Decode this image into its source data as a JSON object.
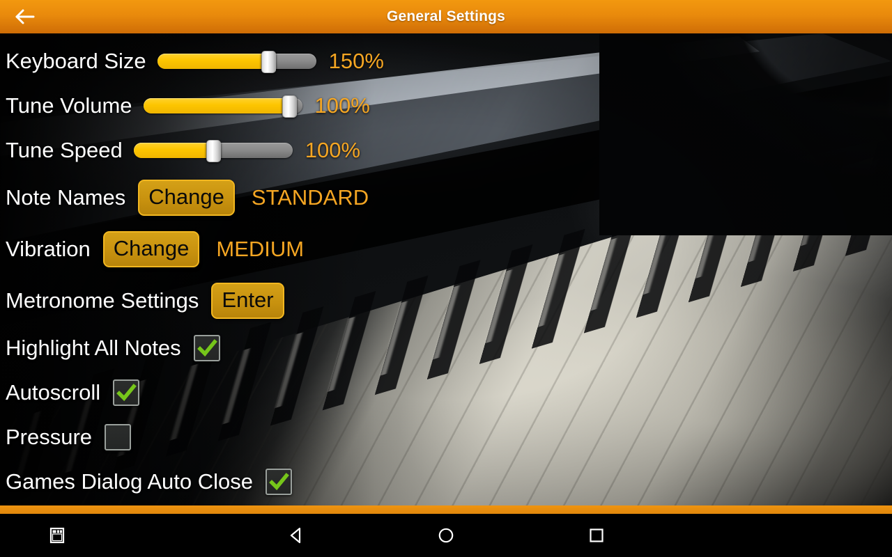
{
  "titlebar": {
    "title": "General Settings",
    "back_icon": "arrow-left-icon",
    "bg_start": "#f2980f",
    "bg_end": "#cf6d06"
  },
  "theme": {
    "label_color": "#ffffff",
    "value_color": "#f5a623",
    "slider_fill": "#fdc500",
    "slider_track": "#8c8c8c",
    "button_fill": "#c8920f",
    "button_border": "#f2b720",
    "check_color": "#76c61a"
  },
  "settings": {
    "rows": [
      {
        "type": "slider",
        "name": "keyboard-size",
        "label": "Keyboard Size",
        "value": "150%",
        "percent": 72
      },
      {
        "type": "slider",
        "name": "tune-volume",
        "label": "Tune Volume",
        "value": "100%",
        "percent": 96
      },
      {
        "type": "slider",
        "name": "tune-speed",
        "label": "Tune Speed",
        "value": "100%",
        "percent": 50
      },
      {
        "type": "button",
        "name": "note-names",
        "label": "Note Names",
        "button": "Change",
        "value": "STANDARD"
      },
      {
        "type": "button",
        "name": "vibration",
        "label": "Vibration",
        "button": "Change",
        "value": "MEDIUM"
      },
      {
        "type": "button",
        "name": "metronome-settings",
        "label": "Metronome Settings",
        "button": "Enter",
        "value": ""
      },
      {
        "type": "checkbox",
        "name": "highlight-all-notes",
        "label": "Highlight All Notes",
        "checked": true
      },
      {
        "type": "checkbox",
        "name": "autoscroll",
        "label": "Autoscroll",
        "checked": true
      },
      {
        "type": "checkbox",
        "name": "pressure",
        "label": "Pressure",
        "checked": false
      },
      {
        "type": "checkbox",
        "name": "games-dialog-auto-close",
        "label": "Games Dialog Auto Close",
        "checked": true
      }
    ]
  },
  "navbar": {
    "buttons": [
      {
        "name": "screenshot-button",
        "icon": "window-icon"
      },
      {
        "name": "back-button",
        "icon": "triangle-back-icon"
      },
      {
        "name": "home-button",
        "icon": "circle-home-icon"
      },
      {
        "name": "recents-button",
        "icon": "square-recents-icon"
      }
    ]
  }
}
